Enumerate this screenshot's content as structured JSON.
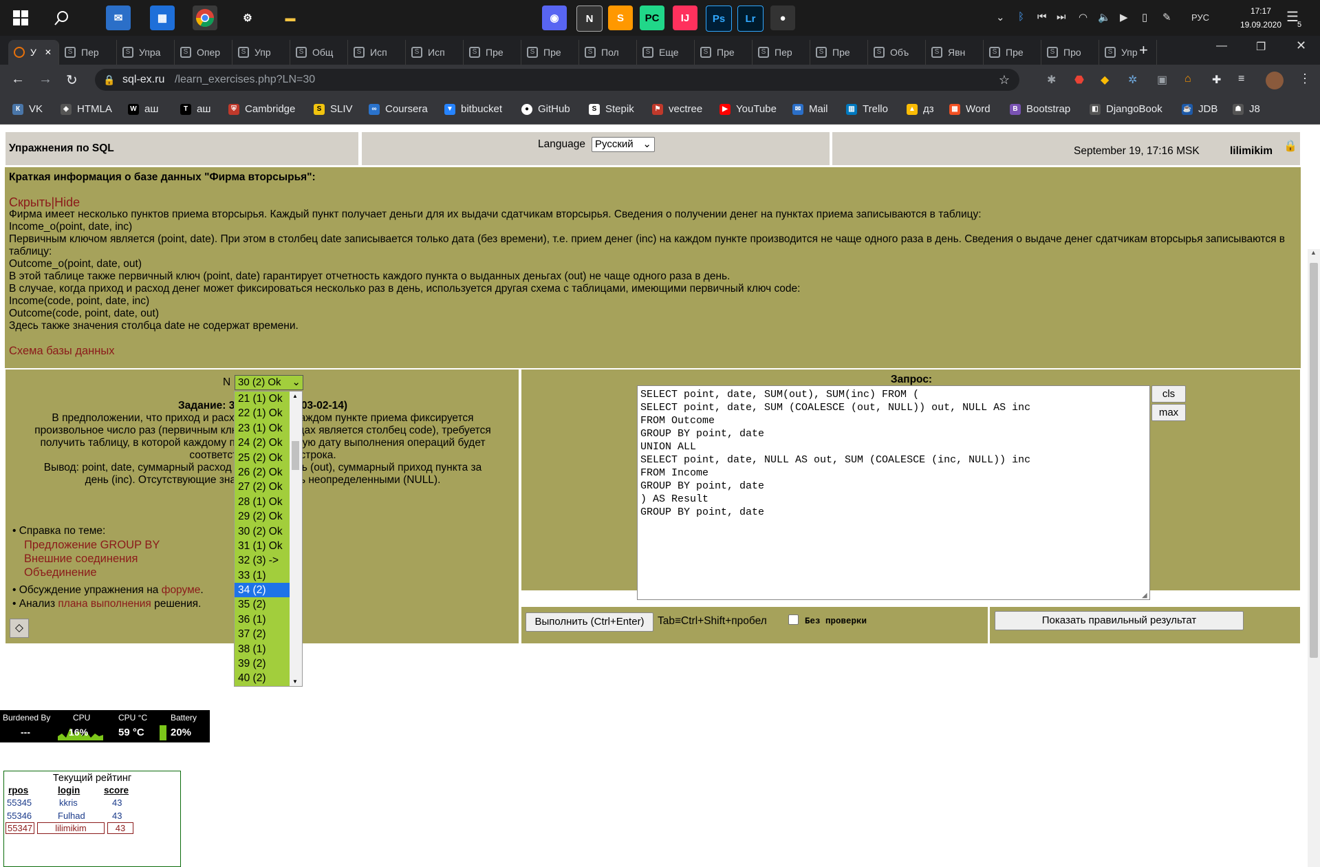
{
  "taskbar": {
    "time": "17:17",
    "date": "19.09.2020",
    "language": "РУС",
    "notifications": "5"
  },
  "tabs": [
    {
      "label": "У",
      "icon": "sqlex-icon"
    },
    {
      "label": "Пер"
    },
    {
      "label": "Упра"
    },
    {
      "label": "Опер"
    },
    {
      "label": "Упр"
    },
    {
      "label": "Общ"
    },
    {
      "label": "Исп"
    },
    {
      "label": "Исп"
    },
    {
      "label": "Пре"
    },
    {
      "label": "Пре"
    },
    {
      "label": "Пол"
    },
    {
      "label": "Еще"
    },
    {
      "label": "Пре"
    },
    {
      "label": "Пер"
    },
    {
      "label": "Пре"
    },
    {
      "label": "Объ"
    },
    {
      "label": "Явн"
    },
    {
      "label": "Пре"
    },
    {
      "label": "Про"
    },
    {
      "label": "Упр"
    }
  ],
  "address": {
    "host": "sql-ex.ru",
    "path": "/learn_exercises.php?LN=30"
  },
  "bookmarks": [
    "VK",
    "HTMLA",
    "аш",
    "аш",
    "Cambridge",
    "SLIV",
    "Coursera",
    "bitbucket",
    "GitHub",
    "Stepik",
    "vectree",
    "YouTube",
    "Mail",
    "Trello",
    "дз",
    "Word",
    "Bootstrap",
    "DjangoBook",
    "JDB",
    "J8"
  ],
  "header": {
    "title": "Упражнения по SQL",
    "language_label": "Language",
    "language_value": "Русский",
    "datetime": "September 19, 17:16 MSK",
    "user": "lilimikim"
  },
  "info": {
    "heading": "Краткая информация о базе данных \"Фирма вторсырья\":",
    "hide_link": "Скрыть|Hide",
    "lines": [
      "Фирма имеет несколько пунктов приема вторсырья. Каждый пункт получает деньги для их выдачи сдатчикам вторсырья. Сведения о получении денег на пунктах приема записываются в таблицу:",
      "Income_o(point, date, inc)",
      "Первичным ключом является (point, date). При этом в столбец date записывается только дата (без времени), т.е. прием денег (inc) на каждом пункте производится не чаще одного раза в день. Сведения о выдаче денег сдатчикам вторсырья записываются в таблицу:",
      "Outcome_o(point, date, out)",
      "В этой таблице также первичный ключ (point, date) гарантирует отчетность каждого пункта о выданных деньгах (out) не чаще одного раза в день.",
      "В случае, когда приход и расход денег может фиксироваться несколько раз в день, используется другая схема с таблицами, имеющими первичный ключ code:",
      "Income(code, point, date, inc)",
      "Outcome(code, point, date, out)",
      "Здесь также значения столбца date не содержат времени."
    ],
    "schema_link": "Схема базы данных"
  },
  "task": {
    "n_label": "N",
    "selected": "30 (2) Ok",
    "title": "Задание: 30 (Serge I: 2003-02-14)",
    "text": [
      "В предположении, что приход и расход денег на каждом пункте приема фиксируется",
      "произвольное число раз (первичным ключом в таблицах является столбец code), требуется",
      "получить таблицу, в которой каждому пункту за каждую дату выполнения операций будет",
      "соответствовать одна строка.",
      "Вывод: point, date, суммарный расход пункта за день (out), суммарный приход пункта за",
      "день (inc). Отсутствующие значения считать неопределенными (NULL)."
    ],
    "help_label": "• Справка по теме:",
    "help_links": [
      "Предложение GROUP BY",
      "Внешние соединения",
      "Объединение"
    ],
    "forum_prefix": "• Обсуждение упражнения на ",
    "forum_link": "форуме",
    "plan_prefix": "• Анализ ",
    "plan_link": "плана выполнения",
    "plan_suffix": " решения."
  },
  "dropdown": {
    "options": [
      "21 (1) Ok",
      "22 (1) Ok",
      "23 (1) Ok",
      "24 (2) Ok",
      "25 (2) Ok",
      "26 (2) Ok",
      "27 (2) Ok",
      "28 (1) Ok",
      "29 (2) Ok",
      "30 (2) Ok",
      "31 (1) Ok",
      "32 (3) ->",
      "33 (1)",
      "34 (2)",
      "35 (2)",
      "36 (1)",
      "37 (2)",
      "38 (1)",
      "39 (2)",
      "40 (2)"
    ],
    "highlighted": "34 (2)"
  },
  "query": {
    "label": "Запрос:",
    "sql": "SELECT point, date, SUM(out), SUM(inc) FROM (\nSELECT point, date, SUM (COALESCE (out, NULL)) out, NULL AS inc\nFROM Outcome\nGROUP BY point, date\nUNION ALL\nSELECT point, date, NULL AS out, SUM (COALESCE (inc, NULL)) inc\nFROM Income\nGROUP BY point, date\n) AS Result\nGROUP BY point, date",
    "cls": "cls",
    "max": "max",
    "run": "Выполнить (Ctrl+Enter)",
    "tab_hint": "Tab≡Ctrl+Shift+пробел",
    "no_check": "Без проверки",
    "show_result": "Показать правильный результат"
  },
  "rating": {
    "title": "Текущий рейтинг",
    "headers": [
      "rpos",
      "login",
      "score"
    ],
    "rows": [
      [
        "55345",
        "kkris",
        "43"
      ],
      [
        "55346",
        "Fulhad",
        "43"
      ],
      [
        "55347",
        "lilimikim",
        "43"
      ]
    ]
  },
  "stats": {
    "burdened_label": "Burdened By",
    "burdened_value": "---",
    "cpu_label": "CPU",
    "cpu_value": "16%",
    "cpu_temp_label": "CPU °C",
    "cpu_temp_value": "59 °C",
    "battery_label": "Battery",
    "battery_value": "20%"
  }
}
